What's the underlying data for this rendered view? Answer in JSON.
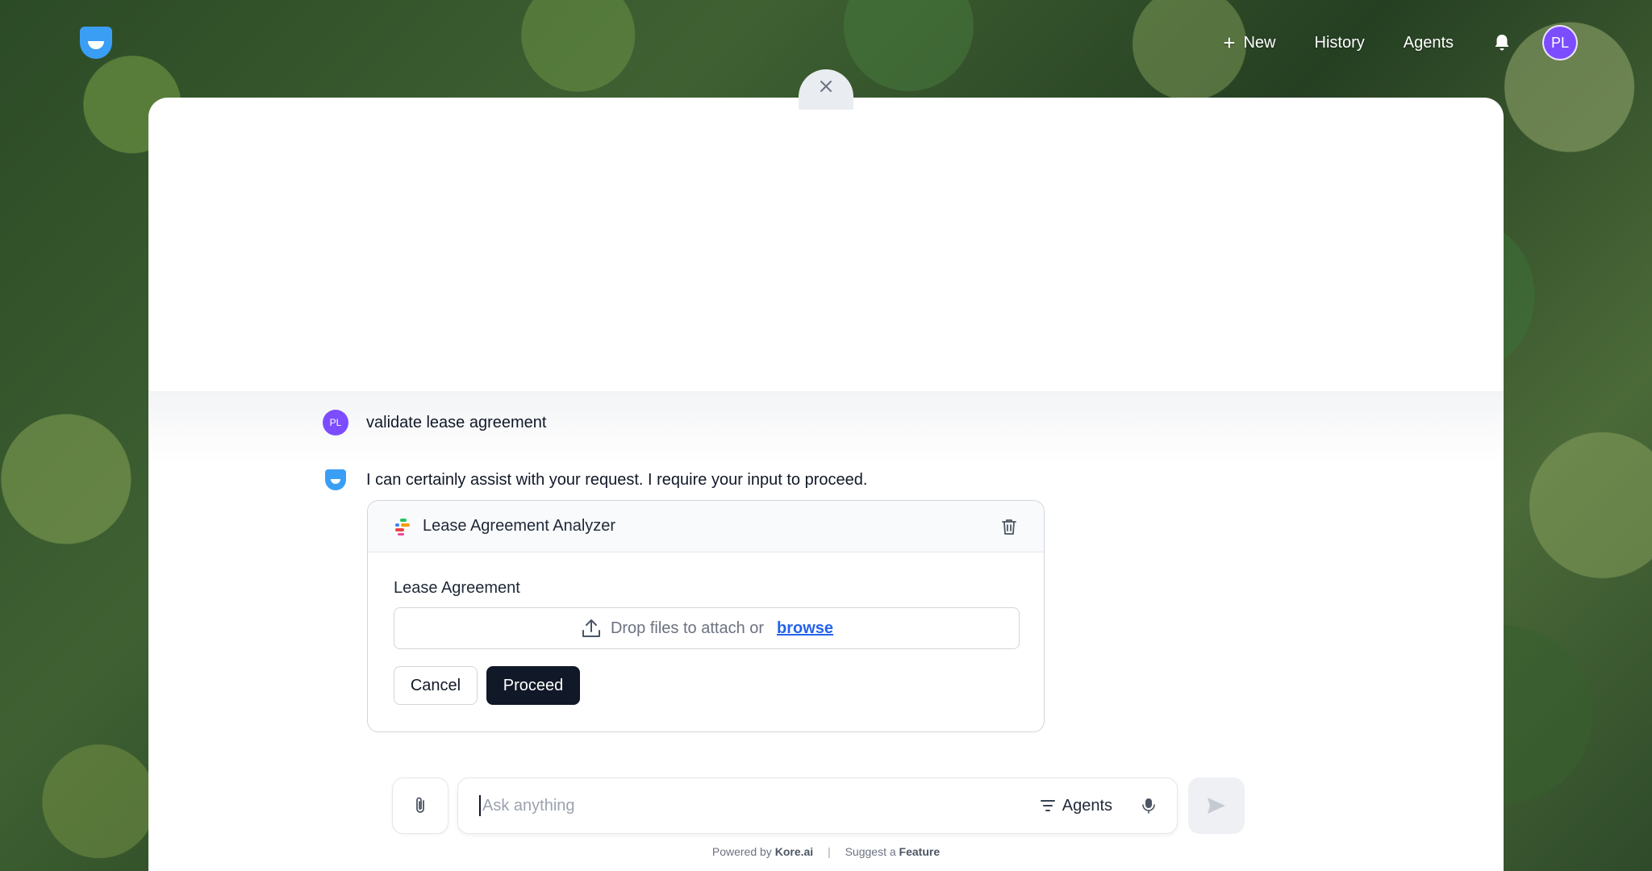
{
  "nav": {
    "new_label": "New",
    "history_label": "History",
    "agents_label": "Agents",
    "user_initials": "PL"
  },
  "conversation": {
    "user_initials": "PL",
    "user_message": "validate lease agreement",
    "bot_message": "I can certainly assist with your request. I require your input to proceed."
  },
  "card": {
    "title": "Lease Agreement Analyzer",
    "field_label": "Lease Agreement",
    "dropzone_text": "Drop files to attach or",
    "browse_label": "browse",
    "cancel_label": "Cancel",
    "proceed_label": "Proceed"
  },
  "composer": {
    "placeholder": "Ask anything",
    "agents_label": "Agents"
  },
  "footer": {
    "powered_prefix": "Powered by",
    "powered_brand": "Kore.ai",
    "separator": "|",
    "suggest_prefix": "Suggest a",
    "suggest_bold": "Feature"
  },
  "colors": {
    "brand_blue": "#3b82f6",
    "avatar_purple": "#7c4dff",
    "proceed_dark": "#111827",
    "link_blue": "#2563eb"
  }
}
